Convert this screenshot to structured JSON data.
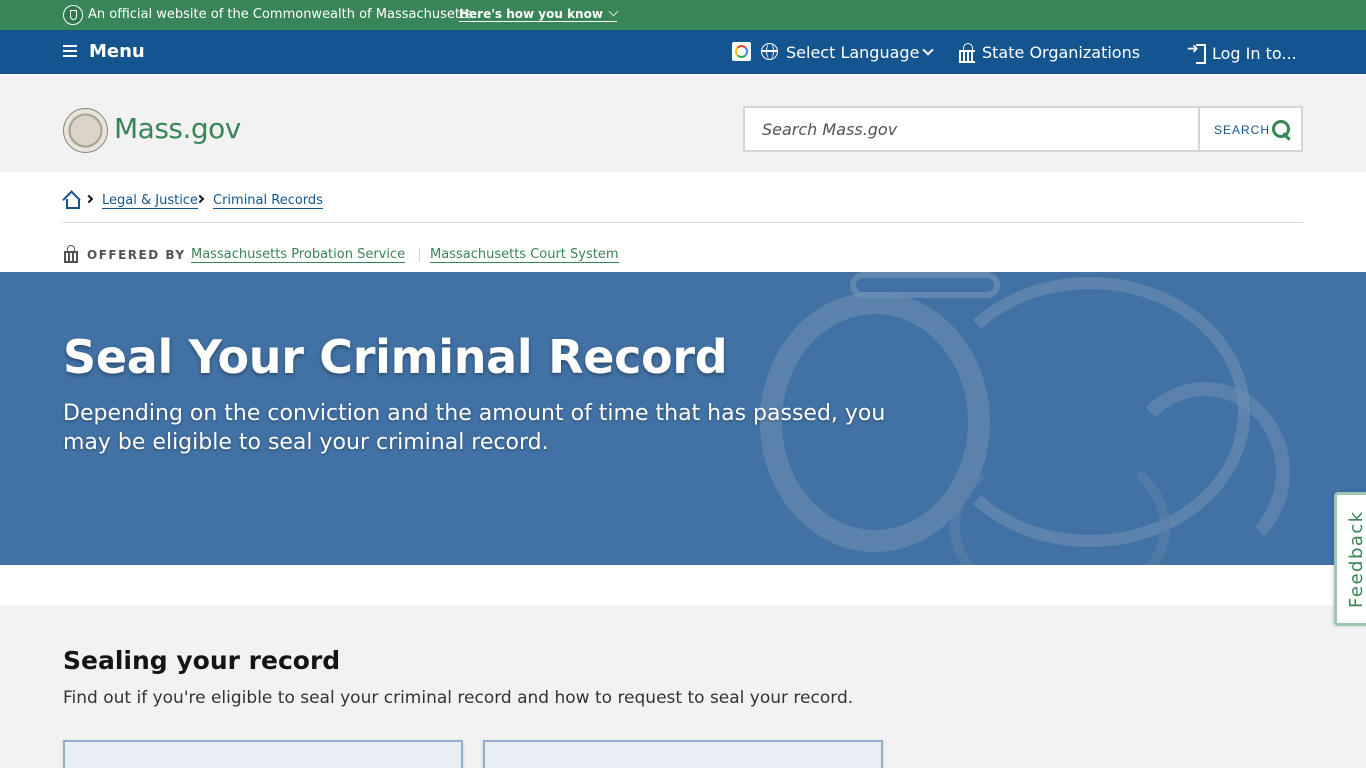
{
  "official_banner": {
    "text": "An official website of the Commonwealth of Massachusetts",
    "how_link": "Here's how you know"
  },
  "utility_nav": {
    "menu_label": "Menu",
    "language_label": "Select Language",
    "state_orgs_label": "State Organizations",
    "login_label": "Log In to..."
  },
  "header": {
    "logo_text": "Mass.gov",
    "search_placeholder": "Search Mass.gov",
    "search_button": "SEARCH"
  },
  "breadcrumb": {
    "items": [
      "Legal & Justice",
      "Criminal Records"
    ]
  },
  "offered_by": {
    "label": "OFFERED BY",
    "orgs": [
      "Massachusetts Probation Service",
      "Massachusetts Court System"
    ]
  },
  "hero": {
    "title": "Seal Your Criminal Record",
    "subtitle": "Depending on the conviction and the amount of time that has passed, you may be eligible to seal your criminal record."
  },
  "section": {
    "title": "Sealing your record",
    "description": "Find out if you're eligible to seal your criminal record and how to request to seal your record."
  },
  "feedback": {
    "label": "Feedback"
  },
  "colors": {
    "banner_green": "#388557",
    "nav_blue": "#14558f",
    "hero_blue": "#4272a5"
  }
}
